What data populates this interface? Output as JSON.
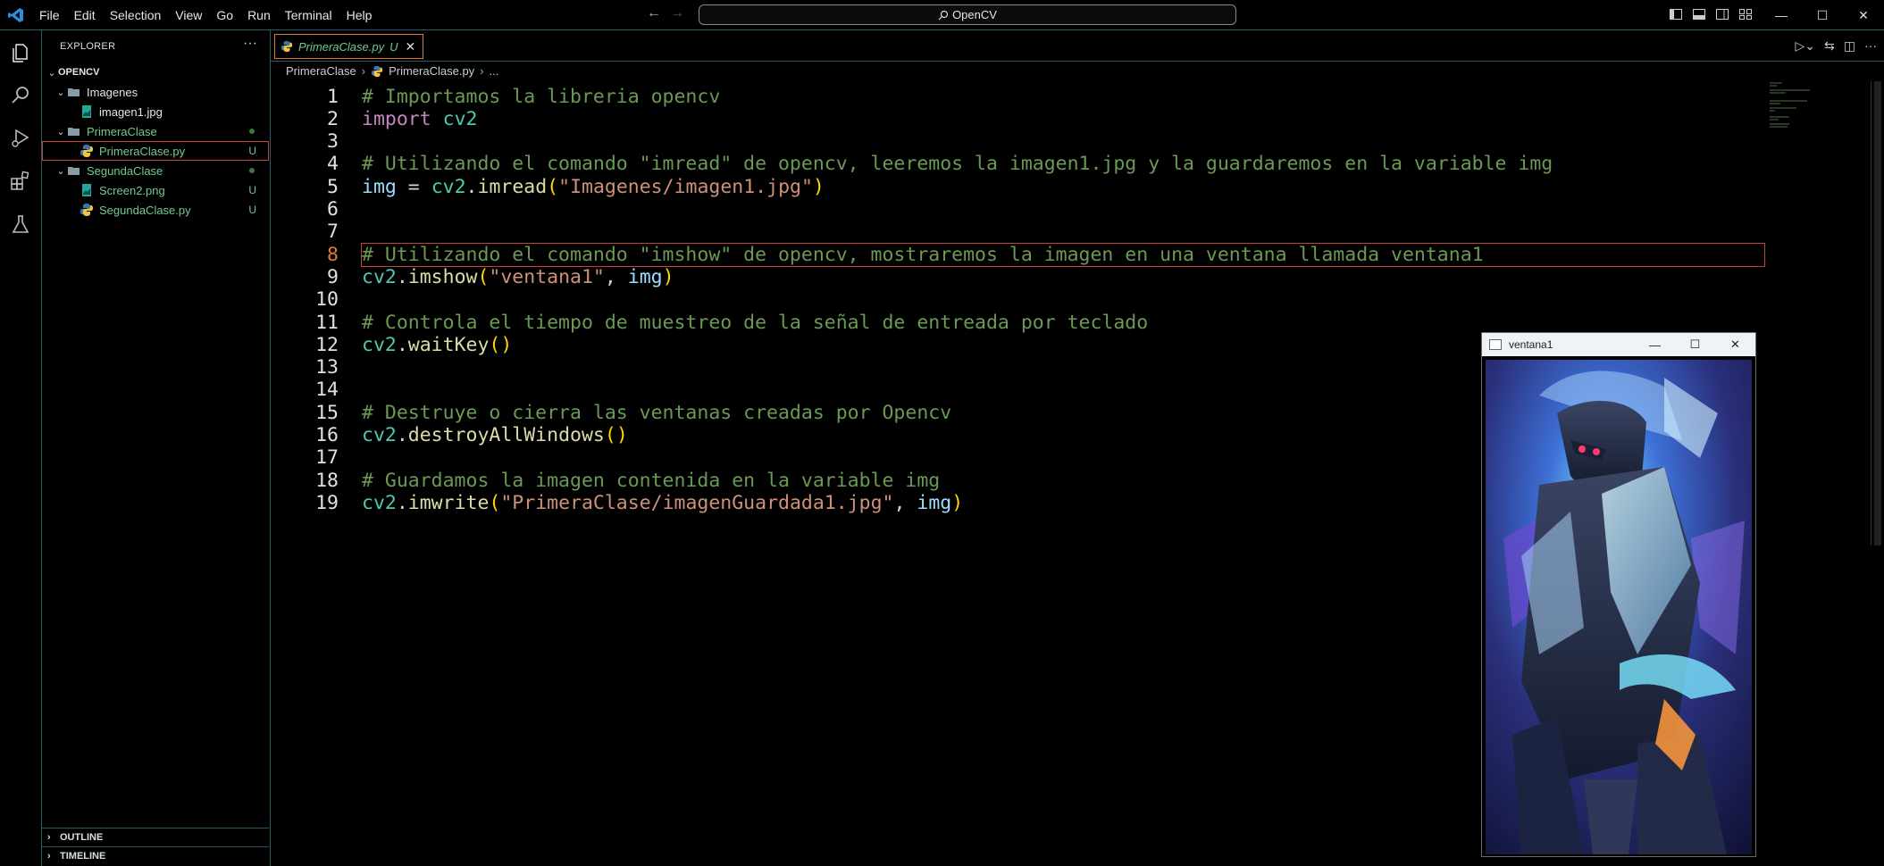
{
  "window": {
    "menu": [
      "File",
      "Edit",
      "Selection",
      "View",
      "Go",
      "Run",
      "Terminal",
      "Help"
    ],
    "search_text": "OpenCV",
    "controls": {
      "minimize": "—",
      "maximize": "☐",
      "close": "✕"
    }
  },
  "activity_bar": {
    "icons": [
      "explorer-icon",
      "search-icon",
      "run-debug-icon",
      "extensions-icon",
      "testing-icon"
    ]
  },
  "sidebar": {
    "header": "EXPLORER",
    "more": "···",
    "root": "OPENCV",
    "tree": [
      {
        "label": "Imagenes",
        "type": "folder",
        "status": ""
      },
      {
        "label": "imagen1.jpg",
        "type": "image",
        "status": ""
      },
      {
        "label": "PrimeraClase",
        "type": "folder",
        "status": "dot"
      },
      {
        "label": "PrimeraClase.py",
        "type": "python",
        "status": "U"
      },
      {
        "label": "SegundaClase",
        "type": "folder",
        "status": "dot"
      },
      {
        "label": "Screen2.png",
        "type": "image",
        "status": "U"
      },
      {
        "label": "SegundaClase.py",
        "type": "python",
        "status": "U"
      }
    ],
    "outline_label": "OUTLINE",
    "timeline_label": "TIMELINE"
  },
  "editor": {
    "tab": {
      "name": "PrimeraClase.py",
      "status": "U",
      "close": "✕"
    },
    "breadcrumb": {
      "folder": "PrimeraClase",
      "file": "PrimeraClase.py",
      "more": "..."
    },
    "active_line": 8,
    "lines": [
      "# Importamos la libreria opencv",
      "import cv2",
      "",
      "# Utilizando el comando \"imread\" de opencv, leeremos la imagen1.jpg y la guardaremos en la variable img",
      "img = cv2.imread(\"Imagenes/imagen1.jpg\")",
      "",
      "",
      "# Utilizando el comando \"imshow\" de opencv, mostraremos la imagen en una ventana llamada ventana1",
      "cv2.imshow(\"ventana1\", img)",
      "",
      "# Controla el tiempo de muestreo de la señal de entreada por teclado",
      "cv2.waitKey()",
      "",
      "",
      "# Destruye o cierra las ventanas creadas por Opencv",
      "cv2.destroyAllWindows()",
      "",
      "# Guardamos la imagen contenida en la variable img",
      "cv2.imwrite(\"PrimeraClase/imagenGuardada1.jpg\", img)"
    ]
  },
  "opencv_window": {
    "title": "ventana1",
    "controls": {
      "minimize": "—",
      "maximize": "☐",
      "close": "✕"
    }
  },
  "colors": {
    "comment": "#6a9955",
    "keyword": "#c586c0",
    "module": "#4ec9b0",
    "function": "#dcdcaa",
    "variable": "#9cdcfe",
    "string": "#ce9178",
    "bracket": "#ffd700",
    "git_untracked": "#73c991",
    "accent_border": "#e07b33"
  }
}
